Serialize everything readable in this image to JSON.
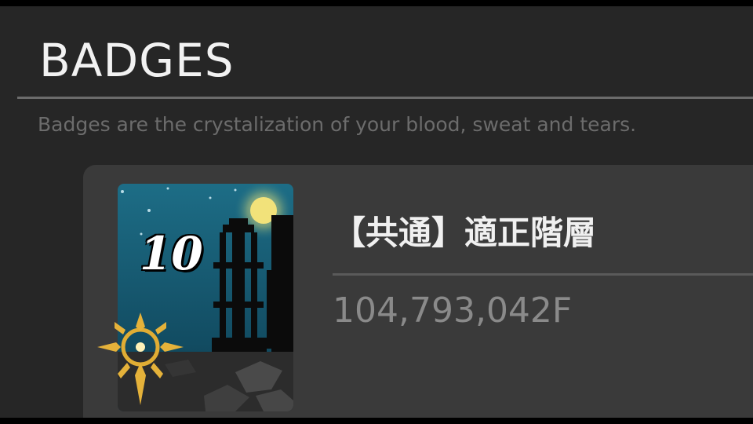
{
  "header": {
    "title": "BADGES",
    "subtitle": "Badges are the crystalization of your blood, sweat and tears."
  },
  "badge": {
    "level": "10",
    "name": "【共通】適正階層",
    "value": "104,793,042F",
    "art_icons": [
      "moon-icon",
      "tower-icon",
      "crest-icon"
    ]
  },
  "colors": {
    "background": "#262626",
    "card": "#3a3a3a",
    "title": "#f2f2f2",
    "subtitle": "#6c6c6c",
    "value": "#8a8a8a",
    "sky": "#145870",
    "moon": "#f2e27a",
    "gold": "#d9a62e"
  }
}
